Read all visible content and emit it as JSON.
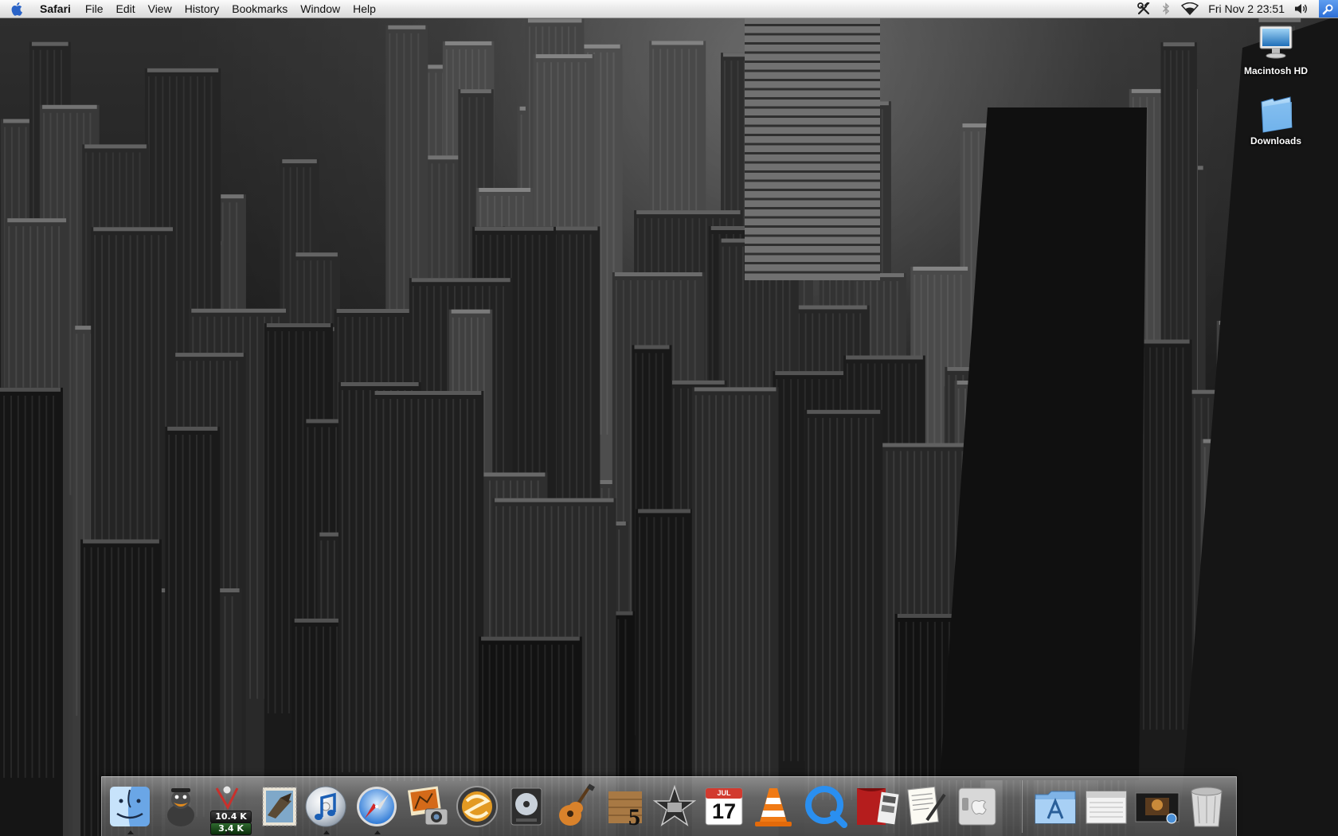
{
  "menubar": {
    "app_name": "Safari",
    "menus": [
      "File",
      "Edit",
      "View",
      "History",
      "Bookmarks",
      "Window",
      "Help"
    ],
    "status": {
      "icons": [
        "tools-icon",
        "bluetooth-icon",
        "wifi-icon"
      ],
      "clock": "Fri Nov 2  23:51",
      "volume_icon": "volume-icon",
      "spotlight_icon": "spotlight-icon"
    }
  },
  "desktop": {
    "icons": [
      {
        "label": "Macintosh HD",
        "icon": "hard-drive-icon"
      },
      {
        "label": "Downloads",
        "icon": "folder-icon"
      }
    ]
  },
  "dock": {
    "apps": [
      {
        "name": "Finder",
        "icon": "finder-icon",
        "running": true
      },
      {
        "name": "Adium",
        "icon": "duck-icon",
        "running": false
      },
      {
        "name": "Network Monitor",
        "icon": "network-monitor-icon",
        "running": true,
        "in": "10.4 K",
        "out": "3.4 K"
      },
      {
        "name": "Mail",
        "icon": "stamp-icon",
        "running": false
      },
      {
        "name": "iTunes",
        "icon": "itunes-icon",
        "running": true
      },
      {
        "name": "Safari",
        "icon": "compass-icon",
        "running": true
      },
      {
        "name": "iPhoto",
        "icon": "photo-camera-icon",
        "running": false
      },
      {
        "name": "Sketchup",
        "icon": "swirl-icon",
        "running": false
      },
      {
        "name": "DVD Player",
        "icon": "dvd-icon",
        "running": false
      },
      {
        "name": "GarageBand",
        "icon": "guitar-icon",
        "running": false
      },
      {
        "name": "Logic",
        "icon": "piano-five-icon",
        "running": false
      },
      {
        "name": "iMovie",
        "icon": "star-icon",
        "running": false
      },
      {
        "name": "iCal",
        "icon": "calendar-icon",
        "running": false,
        "month": "JUL",
        "day": "17"
      },
      {
        "name": "VLC",
        "icon": "traffic-cone-icon",
        "running": false
      },
      {
        "name": "QuickTime",
        "icon": "quicktime-icon",
        "running": false
      },
      {
        "name": "Front Row",
        "icon": "curtain-icon",
        "running": false
      },
      {
        "name": "TextEdit",
        "icon": "document-pen-icon",
        "running": false
      },
      {
        "name": "System Preferences",
        "icon": "apple-switch-icon",
        "running": false
      }
    ],
    "stacks": [
      {
        "name": "Applications",
        "icon": "applications-folder-icon"
      },
      {
        "name": "Documents",
        "icon": "documents-stack-icon"
      },
      {
        "name": "Movies",
        "icon": "movie-thumbnail-icon"
      },
      {
        "name": "Trash",
        "icon": "trash-icon"
      }
    ]
  }
}
